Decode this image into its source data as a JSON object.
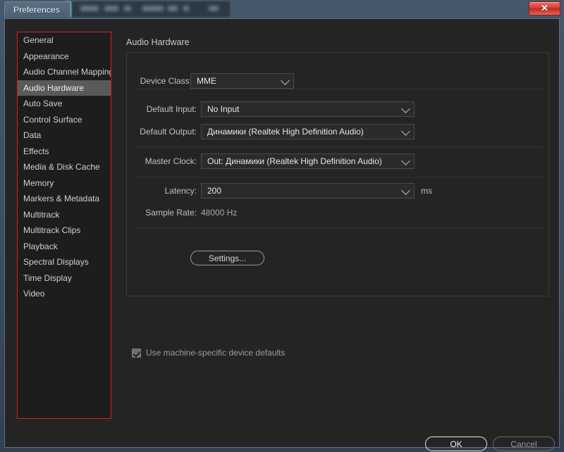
{
  "window": {
    "tab_title": "Preferences",
    "close_label": "✕"
  },
  "sidebar": {
    "items": [
      {
        "label": "General",
        "selected": false
      },
      {
        "label": "Appearance",
        "selected": false
      },
      {
        "label": "Audio Channel Mapping",
        "selected": false
      },
      {
        "label": "Audio Hardware",
        "selected": true
      },
      {
        "label": "Auto Save",
        "selected": false
      },
      {
        "label": "Control Surface",
        "selected": false
      },
      {
        "label": "Data",
        "selected": false
      },
      {
        "label": "Effects",
        "selected": false
      },
      {
        "label": "Media & Disk Cache",
        "selected": false
      },
      {
        "label": "Memory",
        "selected": false
      },
      {
        "label": "Markers & Metadata",
        "selected": false
      },
      {
        "label": "Multitrack",
        "selected": false
      },
      {
        "label": "Multitrack Clips",
        "selected": false
      },
      {
        "label": "Playback",
        "selected": false
      },
      {
        "label": "Spectral Displays",
        "selected": false
      },
      {
        "label": "Time Display",
        "selected": false
      },
      {
        "label": "Video",
        "selected": false
      }
    ],
    "border_color": "#e01b1b",
    "selected_bg": "#5a5a5a"
  },
  "main": {
    "section_title": "Audio Hardware",
    "device_class": {
      "label": "Device Class:",
      "value": "MME"
    },
    "default_input": {
      "label": "Default Input:",
      "value": "No Input"
    },
    "default_output": {
      "label": "Default Output:",
      "value": "Динамики (Realtek High Definition Audio)"
    },
    "master_clock": {
      "label": "Master Clock:",
      "value": "Out: Динамики (Realtek High Definition Audio)"
    },
    "latency": {
      "label": "Latency:",
      "value": "200",
      "unit": "ms"
    },
    "sample_rate": {
      "label": "Sample Rate:",
      "value": "48000 Hz"
    },
    "settings_button": "Settings...",
    "machine_defaults": {
      "label": "Use machine-specific device defaults",
      "checked": true
    }
  },
  "footer": {
    "ok_label": "OK",
    "cancel_label": "Cancel"
  }
}
